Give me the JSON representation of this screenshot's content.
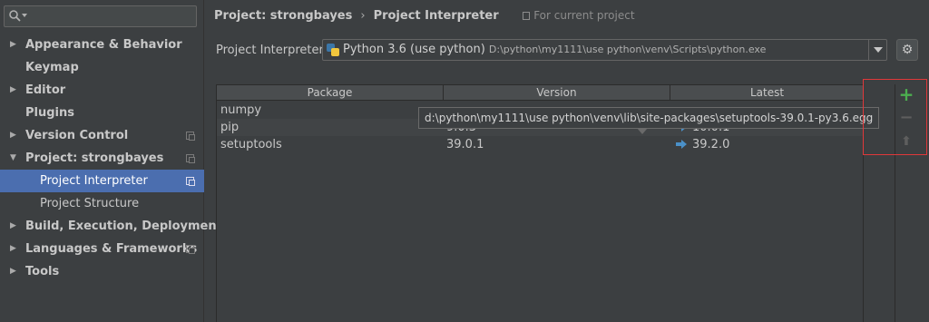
{
  "search": {
    "value": "",
    "placeholder": ""
  },
  "sidebar": {
    "items": [
      {
        "label": "Appearance & Behavior",
        "expandable": true,
        "expanded": false,
        "bold": true,
        "copy_icon": false
      },
      {
        "label": "Keymap",
        "expandable": false,
        "bold": true,
        "copy_icon": false
      },
      {
        "label": "Editor",
        "expandable": true,
        "expanded": false,
        "bold": true,
        "copy_icon": false
      },
      {
        "label": "Plugins",
        "expandable": false,
        "bold": true,
        "copy_icon": false
      },
      {
        "label": "Version Control",
        "expandable": true,
        "expanded": false,
        "bold": true,
        "copy_icon": true
      },
      {
        "label": "Project: strongbayes",
        "expandable": true,
        "expanded": true,
        "bold": true,
        "copy_icon": true
      },
      {
        "label": "Project Interpreter",
        "child": true,
        "selected": true,
        "copy_icon": true
      },
      {
        "label": "Project Structure",
        "child": true,
        "copy_icon": false
      },
      {
        "label": "Build, Execution, Deployment",
        "expandable": true,
        "expanded": false,
        "bold": true,
        "copy_icon": false
      },
      {
        "label": "Languages & Frameworks",
        "expandable": true,
        "expanded": false,
        "bold": true,
        "copy_icon": true
      },
      {
        "label": "Tools",
        "expandable": true,
        "expanded": false,
        "bold": true,
        "copy_icon": false
      }
    ]
  },
  "breadcrumb": {
    "project": "Project: strongbayes",
    "separator": "›",
    "page": "Project Interpreter",
    "scope": "For current project"
  },
  "interpreter": {
    "label": "Project Interpreter:",
    "name": "Python 3.6 (use python)",
    "path": "D:\\python\\my1111\\use python\\venv\\Scripts\\python.exe"
  },
  "table": {
    "columns": [
      "Package",
      "Version",
      "Latest"
    ],
    "rows": [
      {
        "package": "numpy",
        "version": "",
        "latest": "",
        "upgrade": false
      },
      {
        "package": "pip",
        "version": "9.0.3",
        "latest": "10.0.1",
        "upgrade": true
      },
      {
        "package": "setuptools",
        "version": "39.0.1",
        "latest": "39.2.0",
        "upgrade": true
      }
    ]
  },
  "tooltip": {
    "text": "d:\\python\\my1111\\use python\\venv\\lib\\site-packages\\setuptools-39.0.1-py3.6.egg"
  },
  "toolbar": {
    "add": "+",
    "remove": "−",
    "upgrade": "⬆"
  },
  "icons": {
    "search": "search-icon",
    "settings": "gear-icon",
    "python": "python-icon",
    "upgrade": "upgrade-arrow-icon"
  },
  "colors": {
    "selection": "#4b6eaf",
    "add_button": "#4cae4f",
    "upgrade_arrow": "#4a90c8",
    "highlight_box": "#e0383a"
  }
}
